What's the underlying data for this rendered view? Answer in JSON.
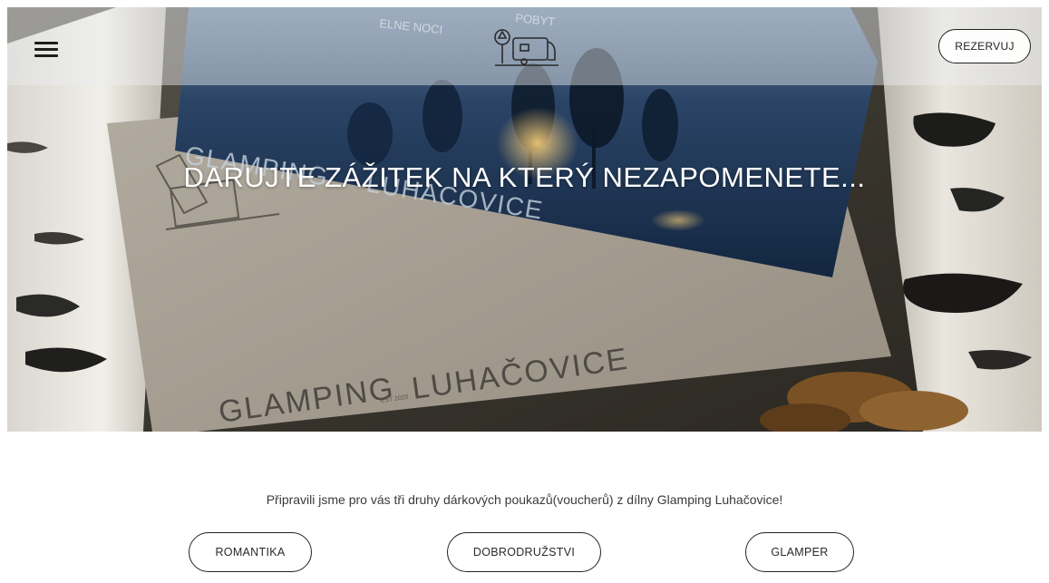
{
  "header": {
    "menu_icon": "hamburger-menu-icon",
    "logo_icon": "tree-and-caravan-logo-icon",
    "reserve_label": "REZERVUJ"
  },
  "hero": {
    "title": "DARUJTE ZÁŽITEK NA KTERÝ NEZAPOMENETE...",
    "photo_text": {
      "card_front_brand": "GLAMPING",
      "card_front_place": "LUHAČOVICE",
      "card_back_brand": "GLAMPING",
      "card_back_place": "LUHAČOVICE",
      "card_back_small": "EST 2020",
      "card_top_fragment_left": "ELNE NOCI",
      "card_top_fragment_right": "POBYT"
    }
  },
  "content": {
    "intro_text": "Připravili jsme pro vás tři druhy dárkových poukazů(voucherů) z dílny Glamping Luhačovice!",
    "vouchers": [
      {
        "label": "ROMANTIKA"
      },
      {
        "label": "DOBRODRUŽSTVI"
      },
      {
        "label": "GLAMPER"
      }
    ]
  },
  "colors": {
    "text_dark": "#222222",
    "hero_title": "#ffffff",
    "card_blue": "#1e3a5f",
    "card_kraft": "#a39b8e"
  }
}
